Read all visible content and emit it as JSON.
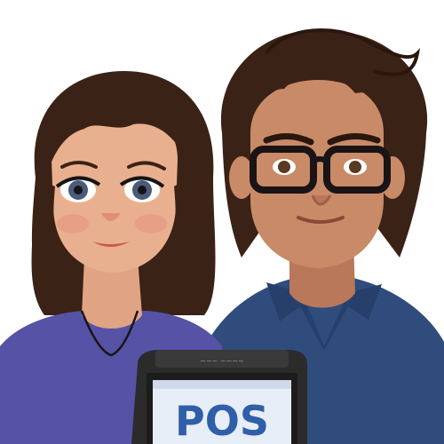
{
  "scene": {
    "description_label": "",
    "terminal": {
      "screen_text": "POS",
      "brand_text": "~~~ ~~~~"
    },
    "colors": {
      "background": "#ffffff",
      "hair": "#3b2216",
      "skin": "#e9b08f",
      "skin_man": "#c98a68",
      "woman_shirt": "#5652a6",
      "man_shirt": "#2f4c7c",
      "glasses": "#1a1414",
      "terminal_body": "#2b2b2b",
      "screen_bg": "#e8eef7",
      "screen_text": "#2f5fa8"
    }
  }
}
